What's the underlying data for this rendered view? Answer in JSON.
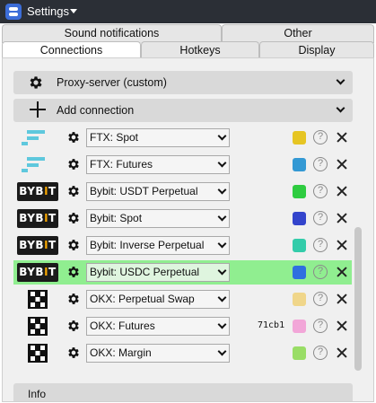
{
  "window": {
    "title": "Settings"
  },
  "tabs": {
    "row1": [
      "Sound notifications",
      "Other"
    ],
    "row2": [
      "Connections",
      "Hotkeys",
      "Display"
    ]
  },
  "proxy": {
    "label": "Proxy-server (custom)"
  },
  "add_connection": {
    "label": "Add connection"
  },
  "connections": [
    {
      "exchange": "ftx",
      "market": "FTX: Spot",
      "color": "#e6c523",
      "note": ""
    },
    {
      "exchange": "ftx",
      "market": "FTX: Futures",
      "color": "#3399d4",
      "note": ""
    },
    {
      "exchange": "bybit",
      "market": "Bybit: USDT Perpetual",
      "color": "#2ecc40",
      "note": ""
    },
    {
      "exchange": "bybit",
      "market": "Bybit: Spot",
      "color": "#3344cc",
      "note": ""
    },
    {
      "exchange": "bybit",
      "market": "Bybit: Inverse Perpetual",
      "color": "#33ccaa",
      "note": ""
    },
    {
      "exchange": "bybit",
      "market": "Bybit: USDC Perpetual",
      "color": "#2f6fe0",
      "note": "",
      "selected": true
    },
    {
      "exchange": "okx",
      "market": "OKX: Perpetual Swap",
      "color": "#f0d68a",
      "note": ""
    },
    {
      "exchange": "okx",
      "market": "OKX: Futures",
      "color": "#f2a6d8",
      "note": "71cb1"
    },
    {
      "exchange": "okx",
      "market": "OKX: Margin",
      "color": "#99dd66",
      "note": ""
    }
  ],
  "info": {
    "label": "Info"
  }
}
